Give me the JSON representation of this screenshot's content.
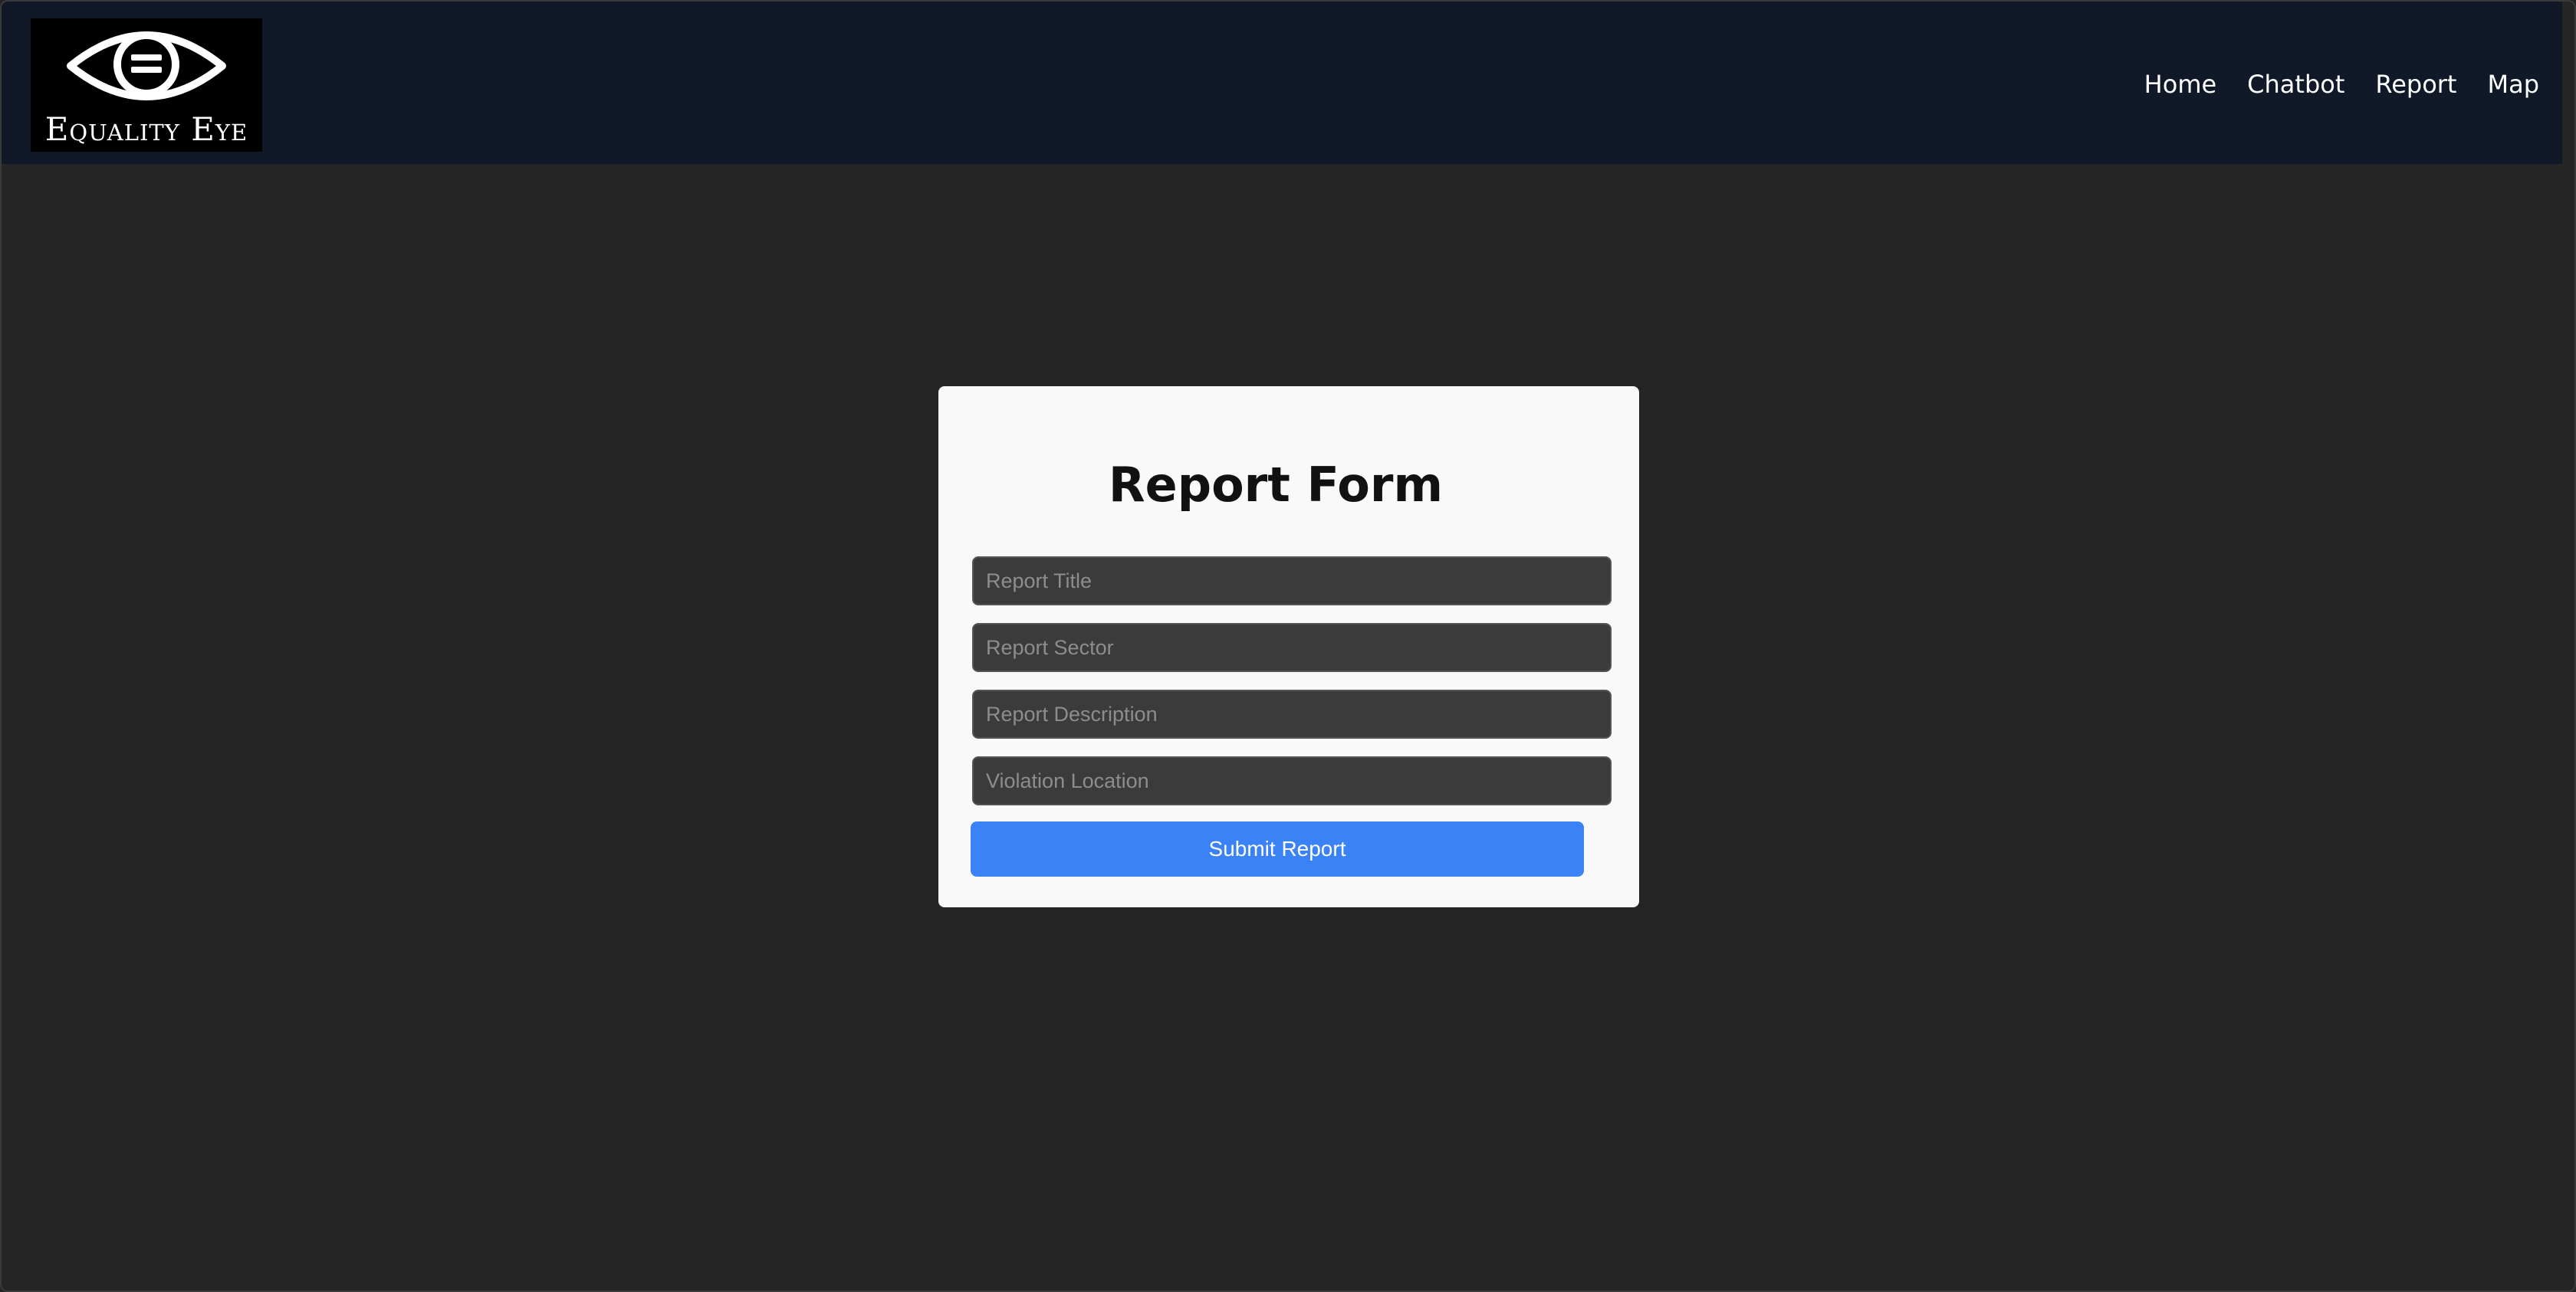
{
  "brand": {
    "name": "Equality Eye",
    "logo_icon": "eye-equal-icon"
  },
  "nav": {
    "items": [
      {
        "label": "Home"
      },
      {
        "label": "Chatbot"
      },
      {
        "label": "Report"
      },
      {
        "label": "Map"
      }
    ]
  },
  "form": {
    "title": "Report Form",
    "fields": [
      {
        "placeholder": "Report Title",
        "value": ""
      },
      {
        "placeholder": "Report Sector",
        "value": ""
      },
      {
        "placeholder": "Report Description",
        "value": ""
      },
      {
        "placeholder": "Violation Location",
        "value": ""
      }
    ],
    "submit_label": "Submit Report"
  },
  "colors": {
    "page_background": "#252525",
    "navbar_background": "#111827",
    "card_background": "#f9f9f9",
    "input_background": "#3b3b3b",
    "accent": "#3b82f6"
  }
}
